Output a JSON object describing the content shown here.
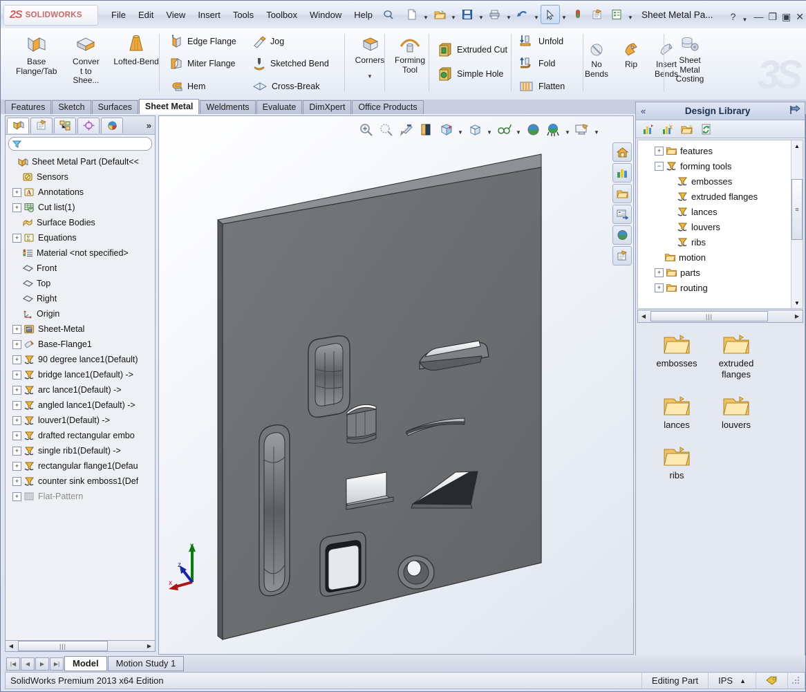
{
  "titlebar": {
    "brand_mark": "2S",
    "brand_word": "SOLIDWORKS",
    "menus": [
      "File",
      "Edit",
      "View",
      "Insert",
      "Tools",
      "Toolbox",
      "Window",
      "Help"
    ],
    "doc_title": "Sheet Metal Pa...",
    "help_glyph": "?",
    "minimize": "—",
    "restore": "❐",
    "maximize": "▣",
    "close": "✕",
    "quick_icons": [
      "new-document-icon",
      "open-folder-icon",
      "save-icon",
      "print-icon",
      "undo-icon",
      "select-arrow-icon",
      "rebuild-icon",
      "options-icon",
      "display-list-icon"
    ]
  },
  "ribbon": {
    "groups": [
      {
        "name": "base",
        "big_buttons": [
          {
            "label": "Base\nFlange/Tab",
            "icon": "base-flange-icon"
          },
          {
            "label": "Convert to Shee...",
            "icon": "convert-to-sheet-metal-icon"
          },
          {
            "label": "Lofted-Bend",
            "icon": "lofted-bend-icon"
          }
        ]
      },
      {
        "name": "flanges",
        "small_buttons": [
          {
            "label": "Edge Flange",
            "icon": "edge-flange-icon"
          },
          {
            "label": "Miter Flange",
            "icon": "miter-flange-icon"
          },
          {
            "label": "Hem",
            "icon": "hem-icon"
          }
        ]
      },
      {
        "name": "bends",
        "small_buttons": [
          {
            "label": "Jog",
            "icon": "jog-icon"
          },
          {
            "label": "Sketched Bend",
            "icon": "sketched-bend-icon"
          },
          {
            "label": "Cross-Break",
            "icon": "cross-break-icon"
          }
        ]
      },
      {
        "name": "corners",
        "big_buttons": [
          {
            "label": "Corners",
            "icon": "corners-icon"
          }
        ],
        "has_dropdown": true
      },
      {
        "name": "forming",
        "big_buttons": [
          {
            "label": "Forming Tool",
            "icon": "forming-tool-icon"
          }
        ]
      },
      {
        "name": "cuts",
        "small_buttons": [
          {
            "label": "Extruded Cut",
            "icon": "extruded-cut-icon"
          },
          {
            "label": "Simple Hole",
            "icon": "simple-hole-icon"
          }
        ]
      },
      {
        "name": "fold",
        "small_buttons": [
          {
            "label": "Unfold",
            "icon": "unfold-icon"
          },
          {
            "label": "Fold",
            "icon": "fold-icon"
          },
          {
            "label": "Flatten",
            "icon": "flatten-icon"
          }
        ]
      },
      {
        "name": "bends2",
        "big_buttons": [
          {
            "label": "No Bends",
            "icon": "no-bends-icon"
          },
          {
            "label": "Rip",
            "icon": "rip-icon"
          },
          {
            "label": "Insert Bends",
            "icon": "insert-bends-icon"
          }
        ]
      },
      {
        "name": "costing",
        "big_buttons": [
          {
            "label": "Sheet Metal Costing",
            "icon": "sheet-metal-costing-icon"
          }
        ]
      }
    ]
  },
  "command_tabs": {
    "items": [
      "Features",
      "Sketch",
      "Surfaces",
      "Sheet Metal",
      "Weldments",
      "Evaluate",
      "DimXpert",
      "Office Products"
    ],
    "active": "Sheet Metal"
  },
  "feature_manager": {
    "tabs": [
      "feature-tree-tab",
      "property-manager-tab",
      "configuration-manager-tab",
      "dimxpert-manager-tab",
      "display-manager-tab"
    ],
    "more_glyph": "»",
    "filter_placeholder": "",
    "filter_value": "",
    "tree": [
      {
        "label": "Sheet Metal Part  (Default<<",
        "icon": "part-icon",
        "indent": 0,
        "expander": "none",
        "dim": false
      },
      {
        "label": "Sensors",
        "icon": "sensors-icon",
        "indent": 1,
        "expander": "none",
        "dim": false
      },
      {
        "label": "Annotations",
        "icon": "annotations-icon",
        "indent": 1,
        "expander": "plus",
        "dim": false
      },
      {
        "label": "Cut list(1)",
        "icon": "cut-list-icon",
        "indent": 1,
        "expander": "plus",
        "dim": false
      },
      {
        "label": "Surface Bodies",
        "icon": "surface-bodies-icon",
        "indent": 1,
        "expander": "none",
        "dim": false
      },
      {
        "label": "Equations",
        "icon": "equations-icon",
        "indent": 1,
        "expander": "plus",
        "dim": false
      },
      {
        "label": "Material <not specified>",
        "icon": "material-icon",
        "indent": 1,
        "expander": "none",
        "dim": false
      },
      {
        "label": "Front",
        "icon": "plane-icon",
        "indent": 1,
        "expander": "none",
        "dim": false
      },
      {
        "label": "Top",
        "icon": "plane-icon",
        "indent": 1,
        "expander": "none",
        "dim": false
      },
      {
        "label": "Right",
        "icon": "plane-icon",
        "indent": 1,
        "expander": "none",
        "dim": false
      },
      {
        "label": "Origin",
        "icon": "origin-icon",
        "indent": 1,
        "expander": "none",
        "dim": false
      },
      {
        "label": "Sheet-Metal",
        "icon": "sheet-metal-icon",
        "indent": 1,
        "expander": "plus",
        "dim": false
      },
      {
        "label": "Base-Flange1",
        "icon": "base-flange-feature-icon",
        "indent": 1,
        "expander": "plus",
        "dim": false
      },
      {
        "label": "90 degree lance1(Default)",
        "icon": "forming-tool-feature-icon",
        "indent": 1,
        "expander": "plus",
        "dim": false
      },
      {
        "label": "bridge lance1(Default) ->",
        "icon": "forming-tool-feature-icon",
        "indent": 1,
        "expander": "plus",
        "dim": false
      },
      {
        "label": "arc lance1(Default) ->",
        "icon": "forming-tool-feature-icon",
        "indent": 1,
        "expander": "plus",
        "dim": false
      },
      {
        "label": "angled lance1(Default) ->",
        "icon": "forming-tool-feature-icon",
        "indent": 1,
        "expander": "plus",
        "dim": false
      },
      {
        "label": "louver1(Default) ->",
        "icon": "forming-tool-feature-icon",
        "indent": 1,
        "expander": "plus",
        "dim": false
      },
      {
        "label": "drafted rectangular embo",
        "icon": "forming-tool-feature-icon",
        "indent": 1,
        "expander": "plus",
        "dim": false
      },
      {
        "label": "single rib1(Default) ->",
        "icon": "forming-tool-feature-icon",
        "indent": 1,
        "expander": "plus",
        "dim": false
      },
      {
        "label": "rectangular flange1(Defau",
        "icon": "forming-tool-feature-icon",
        "indent": 1,
        "expander": "plus",
        "dim": false
      },
      {
        "label": "counter sink emboss1(Def",
        "icon": "forming-tool-feature-icon",
        "indent": 1,
        "expander": "plus",
        "dim": false
      },
      {
        "label": "Flat-Pattern",
        "icon": "flat-pattern-icon",
        "indent": 1,
        "expander": "plus",
        "dim": true
      }
    ]
  },
  "viewport": {
    "toolbar_icons": [
      "zoom-to-fit-icon",
      "zoom-to-area-icon",
      "previous-view-icon",
      "section-view-icon",
      "view-orientation-icon",
      "display-style-icon",
      "hide-show-items-icon",
      "edit-appearance-icon",
      "apply-scene-icon",
      "view-settings-icon"
    ],
    "right_icons": [
      "home-view-icon",
      "view-palette-icon",
      "open-folder-icon",
      "task-pane-icon",
      "appearances-icon",
      "custom-properties-icon"
    ],
    "triad": {
      "x_label": "x",
      "y_label": "y",
      "z_label": "z"
    }
  },
  "design_library": {
    "title": "Design Library",
    "collapse_glyph": "«",
    "pin_icon": "pin-icon",
    "toolbar_icons": [
      "add-to-library-icon",
      "add-file-location-icon",
      "create-new-folder-icon",
      "refresh-icon"
    ],
    "tree": [
      {
        "label": "features",
        "icon": "folder-icon",
        "indent": 1,
        "expander": "plus"
      },
      {
        "label": "forming tools",
        "icon": "forming-tool-folder-icon",
        "indent": 1,
        "expander": "minus"
      },
      {
        "label": "embosses",
        "icon": "forming-tool-folder-icon",
        "indent": 2,
        "expander": "none"
      },
      {
        "label": "extruded flanges",
        "icon": "forming-tool-folder-icon",
        "indent": 2,
        "expander": "none"
      },
      {
        "label": "lances",
        "icon": "forming-tool-folder-icon",
        "indent": 2,
        "expander": "none"
      },
      {
        "label": "louvers",
        "icon": "forming-tool-folder-icon",
        "indent": 2,
        "expander": "none"
      },
      {
        "label": "ribs",
        "icon": "forming-tool-folder-icon",
        "indent": 2,
        "expander": "none"
      },
      {
        "label": "motion",
        "icon": "folder-icon",
        "indent": 1,
        "expander": "none"
      },
      {
        "label": "parts",
        "icon": "folder-icon",
        "indent": 1,
        "expander": "plus"
      },
      {
        "label": "routing",
        "icon": "folder-icon",
        "indent": 1,
        "expander": "plus"
      }
    ],
    "grid_items": [
      {
        "label": "embosses",
        "icon": "folder-icon"
      },
      {
        "label": "extruded flanges",
        "icon": "folder-icon"
      },
      {
        "label": "lances",
        "icon": "folder-icon"
      },
      {
        "label": "louvers",
        "icon": "folder-icon"
      },
      {
        "label": "ribs",
        "icon": "folder-icon"
      }
    ]
  },
  "bottom": {
    "tabs": [
      "Model",
      "Motion Study 1"
    ],
    "active_tab": "Model",
    "nav_buttons": [
      "first-icon",
      "previous-icon",
      "next-icon",
      "last-icon"
    ]
  },
  "statusbar": {
    "left_text": "SolidWorks Premium 2013 x64 Edition",
    "editing_state": "Editing Part",
    "units": "IPS",
    "units_caret": "▲",
    "tag_icon": "tag-icon",
    "resize_grip": "resize-grip-icon"
  },
  "colors": {
    "brand_red": "#c96a66",
    "panel_blue": "#c7d1e6",
    "model_gray": "#6e7072",
    "accent": "#2b5fa8"
  }
}
